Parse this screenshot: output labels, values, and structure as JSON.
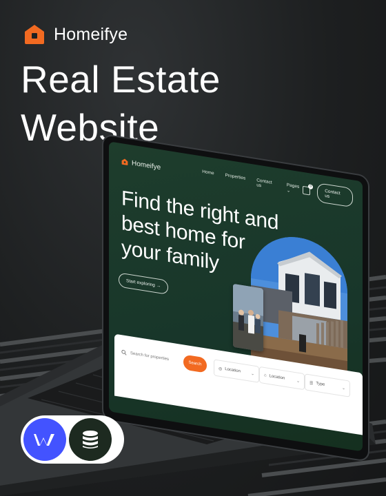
{
  "brand": {
    "name": "Homeifye",
    "accent": "#f26a21"
  },
  "headline": {
    "line1": "Real Estate",
    "line2": "Website"
  },
  "site": {
    "logo": "Homeifye",
    "menu": [
      "Home",
      "Properties",
      "Contact us",
      "Pages ⌄"
    ],
    "cart_count": "0",
    "contact_button": "Contact us",
    "hero_title": [
      "Find the right and",
      "best home for",
      "your family"
    ],
    "explore_button": "Start exploring →",
    "search": {
      "placeholder": "Search for properties",
      "button": "Search",
      "filters": [
        "Location",
        "Location",
        "Type"
      ]
    },
    "theme_color": "#1b3a2a"
  },
  "badges": {
    "left": "webflow-icon",
    "right": "cms-database-icon"
  }
}
